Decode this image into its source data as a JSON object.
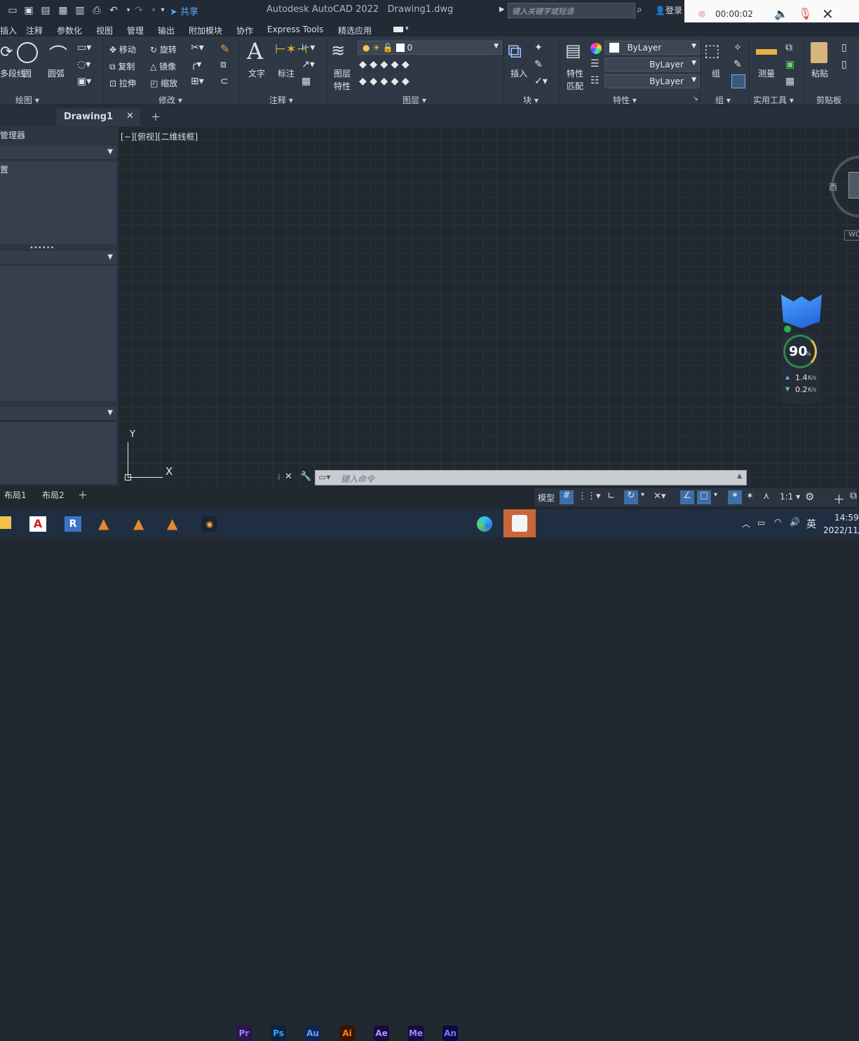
{
  "titlebar": {
    "share_label": "共享",
    "app_title": "Autodesk AutoCAD 2022",
    "doc_title": "Drawing1.dwg",
    "search_placeholder": "键入关键字或短语",
    "login_label": "登录"
  },
  "recorder": {
    "time": "00:00:02"
  },
  "menubar": {
    "items": [
      "插入",
      "注释",
      "参数化",
      "视图",
      "管理",
      "输出",
      "附加模块",
      "协作",
      "Express Tools",
      "精选应用"
    ]
  },
  "ribbon": {
    "draw": {
      "title": "绘图",
      "btn_polyline": "多段线",
      "btn_circle": "圆",
      "btn_arc": "圆弧"
    },
    "modify": {
      "title": "修改",
      "move": "移动",
      "rotate": "旋转",
      "copy": "复制",
      "mirror": "镜像",
      "stretch": "拉伸",
      "scale": "缩放"
    },
    "annotation": {
      "title": "注释",
      "text": "文字",
      "dimension": "标注"
    },
    "layers": {
      "title": "图层",
      "layer_props_1": "图层",
      "layer_props_2": "特性",
      "current_layer": "0"
    },
    "block": {
      "title": "块",
      "insert": "插入"
    },
    "properties": {
      "title": "特性",
      "match_1": "特性",
      "match_2": "匹配",
      "color": "ByLayer",
      "linetype": "ByLayer",
      "lineweight": "ByLayer"
    },
    "groups": {
      "title": "组",
      "group": "组"
    },
    "utilities": {
      "title": "实用工具",
      "measure": "测量"
    },
    "clipboard": {
      "title": "剪贴板",
      "paste": "粘贴"
    }
  },
  "tabs": {
    "drawing_tab": "Drawing1"
  },
  "left_palette": {
    "header": "管理器",
    "item": "置"
  },
  "viewport": {
    "label": "[−][俯视][二维线框]",
    "viewcube_west": "西",
    "wcs": "WC",
    "ucs_x": "X",
    "ucs_y": "Y"
  },
  "command": {
    "placeholder": "键入命令"
  },
  "status": {
    "layout_tabs": [
      "布局1",
      "布局2"
    ],
    "model_label": "模型",
    "scale_label": "1:1"
  },
  "widget": {
    "percent": "90",
    "percent_unit": "%",
    "up_speed": "1.4",
    "down_speed": "0.2",
    "speed_unit": "K/s"
  },
  "taskbar": {
    "apps": [
      "Pr",
      "Ps",
      "Au",
      "Ai",
      "Ae",
      "Me",
      "An"
    ],
    "app_colors": [
      "#9b7cff",
      "#2ea8ff",
      "#6b9bff",
      "#ff7c1f",
      "#a29cff",
      "#8e8cff",
      "#7a7aff"
    ],
    "ime": "英",
    "time": "14:59",
    "date": "2022/11/"
  }
}
